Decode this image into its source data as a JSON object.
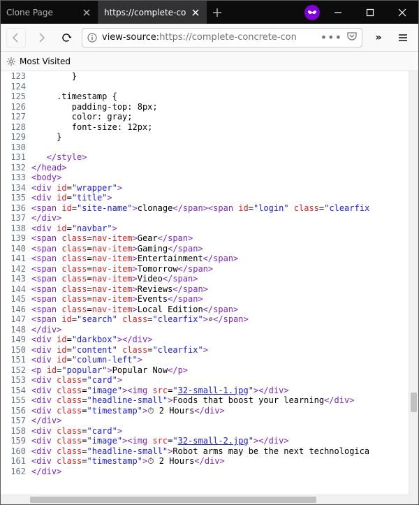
{
  "tabs": {
    "inactive": {
      "label": "Clone Page"
    },
    "active": {
      "label": "https://complete-co"
    }
  },
  "url": {
    "prefix": "view-source:",
    "value": "https://complete-concrete-con"
  },
  "bookmarks": {
    "most_visited": "Most Visited"
  },
  "lines": {
    "start": 123,
    "rows": [
      {
        "html": "        }"
      },
      {
        "html": ""
      },
      {
        "html": "     .timestamp {"
      },
      {
        "html": "        padding-top: 8px;"
      },
      {
        "html": "        color: gray;"
      },
      {
        "html": "        font-size: 12px;"
      },
      {
        "html": "     }"
      },
      {
        "html": ""
      },
      {
        "html": "   <span class=\"tag\">&lt;/style&gt;</span>"
      },
      {
        "html": "<span class=\"tag\">&lt;/head&gt;</span>"
      },
      {
        "html": "<span class=\"tag\">&lt;body&gt;</span>"
      },
      {
        "html": "<span class=\"tag\">&lt;div</span> <span class=\"attr\">id</span>=<span class=\"val\">\"wrapper\"</span><span class=\"tag\">&gt;</span>"
      },
      {
        "html": "<span class=\"tag\">&lt;div</span> <span class=\"attr\">id</span>=<span class=\"val\">\"title\"</span><span class=\"tag\">&gt;</span>"
      },
      {
        "html": "<span class=\"tag\">&lt;span</span> <span class=\"attr\">id</span>=<span class=\"val\">\"site-name\"</span><span class=\"tag\">&gt;</span>clonage<span class=\"tag\">&lt;/span&gt;&lt;span</span> <span class=\"attr\">id</span>=<span class=\"val\">\"login\"</span> <span class=\"attr\">class</span>=<span class=\"val\">\"clearfix</span>"
      },
      {
        "html": "<span class=\"tag\">&lt;/div&gt;</span>"
      },
      {
        "html": "<span class=\"tag\">&lt;div</span> <span class=\"attr\">id</span>=<span class=\"val\">\"navbar\"</span><span class=\"tag\">&gt;</span>"
      },
      {
        "html": "<span class=\"tag\">&lt;span</span> <span class=\"attr\">class</span>=<span class=\"attr\">nav-item</span><span class=\"tag\">&gt;</span>Gear<span class=\"tag\">&lt;/span&gt;</span>"
      },
      {
        "html": "<span class=\"tag\">&lt;span</span> <span class=\"attr\">class</span>=<span class=\"attr\">nav-item</span><span class=\"tag\">&gt;</span>Gaming<span class=\"tag\">&lt;/span&gt;</span>"
      },
      {
        "html": "<span class=\"tag\">&lt;span</span> <span class=\"attr\">class</span>=<span class=\"attr\">nav-item</span><span class=\"tag\">&gt;</span>Entertainment<span class=\"tag\">&lt;/span&gt;</span>"
      },
      {
        "html": "<span class=\"tag\">&lt;span</span> <span class=\"attr\">class</span>=<span class=\"attr\">nav-item</span><span class=\"tag\">&gt;</span>Tomorrow<span class=\"tag\">&lt;/span&gt;</span>"
      },
      {
        "html": "<span class=\"tag\">&lt;span</span> <span class=\"attr\">class</span>=<span class=\"attr\">nav-item</span><span class=\"tag\">&gt;</span>Video<span class=\"tag\">&lt;/span&gt;</span>"
      },
      {
        "html": "<span class=\"tag\">&lt;span</span> <span class=\"attr\">class</span>=<span class=\"attr\">nav-item</span><span class=\"tag\">&gt;</span>Reviews<span class=\"tag\">&lt;/span&gt;</span>"
      },
      {
        "html": "<span class=\"tag\">&lt;span</span> <span class=\"attr\">class</span>=<span class=\"attr\">nav-item</span><span class=\"tag\">&gt;</span>Events<span class=\"tag\">&lt;/span&gt;</span>"
      },
      {
        "html": "<span class=\"tag\">&lt;span</span> <span class=\"attr\">class</span>=<span class=\"attr\">nav-item</span><span class=\"tag\">&gt;</span>Local Edition<span class=\"tag\">&lt;/span&gt;</span>"
      },
      {
        "html": "<span class=\"tag\">&lt;span</span> <span class=\"attr\">id</span>=<span class=\"val\">\"search\"</span> <span class=\"attr\">class</span>=<span class=\"val\">\"clearfix\"</span><span class=\"tag\">&gt;</span>&#8981;<span class=\"tag\">&lt;/span&gt;</span>"
      },
      {
        "html": "<span class=\"tag\">&lt;/div&gt;</span>"
      },
      {
        "html": "<span class=\"tag\">&lt;div</span> <span class=\"attr\">id</span>=<span class=\"val\">\"darkbox\"</span><span class=\"tag\">&gt;&lt;/div&gt;</span>"
      },
      {
        "html": "<span class=\"tag\">&lt;div</span> <span class=\"attr\">id</span>=<span class=\"val\">\"content\"</span> <span class=\"attr\">class</span>=<span class=\"val\">\"clearfix\"</span><span class=\"tag\">&gt;</span>"
      },
      {
        "html": "<span class=\"tag\">&lt;div</span> <span class=\"attr\">id</span>=<span class=\"val\">\"column-left\"</span><span class=\"tag\">&gt;</span>"
      },
      {
        "html": "<span class=\"tag\">&lt;p</span> <span class=\"attr\">id</span>=<span class=\"val\">\"popular\"</span><span class=\"tag\">&gt;</span>Popular Now<span class=\"tag\">&lt;/p&gt;</span>"
      },
      {
        "html": "<span class=\"tag\">&lt;div</span> <span class=\"attr\">class</span>=<span class=\"val\">\"card\"</span><span class=\"tag\">&gt;</span>"
      },
      {
        "html": "<span class=\"tag\">&lt;div</span> <span class=\"attr\">class</span>=<span class=\"val\">\"image\"</span><span class=\"tag\">&gt;&lt;img</span> <span class=\"attr\">src</span>=<span class=\"val\">\"<u>32-small-1.jpg</u>\"</span><span class=\"tag\">&gt;&lt;/div&gt;</span>"
      },
      {
        "html": "<span class=\"tag\">&lt;div</span> <span class=\"attr\">class</span>=<span class=\"val\">\"headline-small\"</span><span class=\"tag\">&gt;</span>Foods that boost your learning<span class=\"tag\">&lt;/div&gt;</span>"
      },
      {
        "html": "<span class=\"tag\">&lt;div</span> <span class=\"attr\">class</span>=<span class=\"val\">\"timestamp\"</span><span class=\"tag\">&gt;</span>&#9201; 2 Hours<span class=\"tag\">&lt;/div&gt;</span>"
      },
      {
        "html": "<span class=\"tag\">&lt;/div&gt;</span>"
      },
      {
        "html": "<span class=\"tag\">&lt;div</span> <span class=\"attr\">class</span>=<span class=\"val\">\"card\"</span><span class=\"tag\">&gt;</span>"
      },
      {
        "html": "<span class=\"tag\">&lt;div</span> <span class=\"attr\">class</span>=<span class=\"val\">\"image\"</span><span class=\"tag\">&gt;&lt;img</span> <span class=\"attr\">src</span>=<span class=\"val\">\"<u>32-small-2.jpg</u>\"</span><span class=\"tag\">&gt;&lt;/div&gt;</span>"
      },
      {
        "html": "<span class=\"tag\">&lt;div</span> <span class=\"attr\">class</span>=<span class=\"val\">\"headline-small\"</span><span class=\"tag\">&gt;</span>Robot arms may be the next technologica"
      },
      {
        "html": "<span class=\"tag\">&lt;div</span> <span class=\"attr\">class</span>=<span class=\"val\">\"timestamp\"</span><span class=\"tag\">&gt;</span>&#9201; 2 Hours<span class=\"tag\">&lt;/div&gt;</span>"
      },
      {
        "html": "<span class=\"tag\">&lt;/div&gt;</span>"
      }
    ]
  }
}
